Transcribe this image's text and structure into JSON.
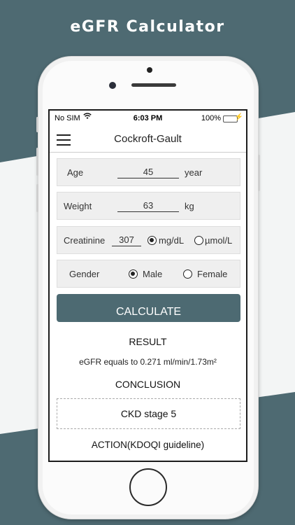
{
  "banner": {
    "title": "eGFR Calculator"
  },
  "status_bar": {
    "carrier": "No SIM",
    "wifi_icon": "wifi-icon",
    "time": "6:03 PM",
    "battery_pct": "100%",
    "battery_fill": 1.0
  },
  "navbar": {
    "menu_icon": "hamburger-icon",
    "title": "Cockroft-Gault"
  },
  "form": {
    "age": {
      "label": "Age",
      "value": "45",
      "unit": "year"
    },
    "weight": {
      "label": "Weight",
      "value": "63",
      "unit": "kg"
    },
    "creatinine": {
      "label": "Creatinine",
      "value": "307",
      "unit_mg": "mg/dL",
      "unit_umol": "µmol/L",
      "selected": "mg/dL"
    },
    "gender": {
      "label": "Gender",
      "male": "Male",
      "female": "Female",
      "selected": "Male"
    }
  },
  "calculate_label": "CALCULATE",
  "result": {
    "heading": "RESULT",
    "text": "eGFR equals to 0.271 ml/min/1.73m²"
  },
  "conclusion": {
    "heading": "CONCLUSION",
    "stage": "CKD stage 5"
  },
  "action": {
    "heading": "ACTION(KDOQI guideline)"
  },
  "colors": {
    "accent": "#4d6a72",
    "background": "#4e6a72",
    "battery": "#4cd964"
  }
}
